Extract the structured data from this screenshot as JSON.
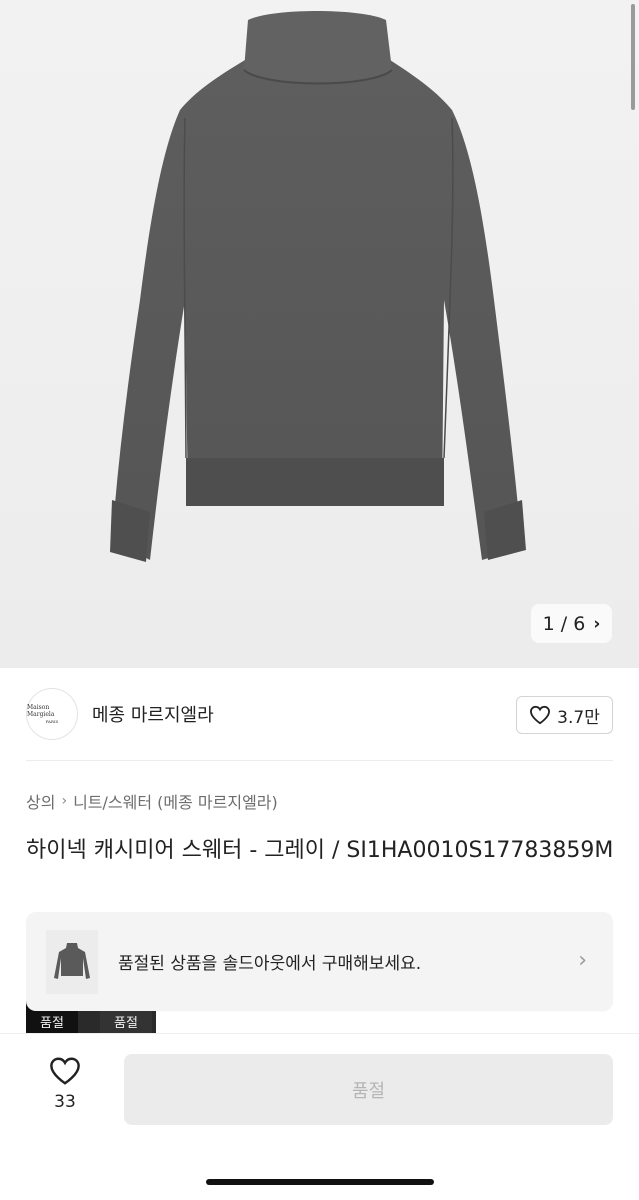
{
  "gallery": {
    "current": "1",
    "separator": "/",
    "total": "6",
    "image_icon": "sweater-photo"
  },
  "brand": {
    "logo_text": "Maison Margiela",
    "logo_sub": "PARIS",
    "name": "메종 마르지엘라",
    "like_count": "3.7만"
  },
  "breadcrumb": {
    "level1": "상의",
    "level2": "니트/스웨터 (메종 마르지엘라)"
  },
  "product": {
    "title": "하이넥 캐시미어 스웨터 - 그레이 / SI1HA0010S17783859M"
  },
  "thumbnails_peek": {
    "label1": "품절",
    "label2": "품절"
  },
  "soldout_banner": {
    "text": "품절된 상품을 솔드아웃에서 구매해보세요."
  },
  "bottom": {
    "wish_count": "33",
    "buy_label": "품절"
  },
  "colors": {
    "sweater": "#5a5a5a",
    "hero_bg": "#efefef",
    "button_disabled": "#ebebeb"
  }
}
